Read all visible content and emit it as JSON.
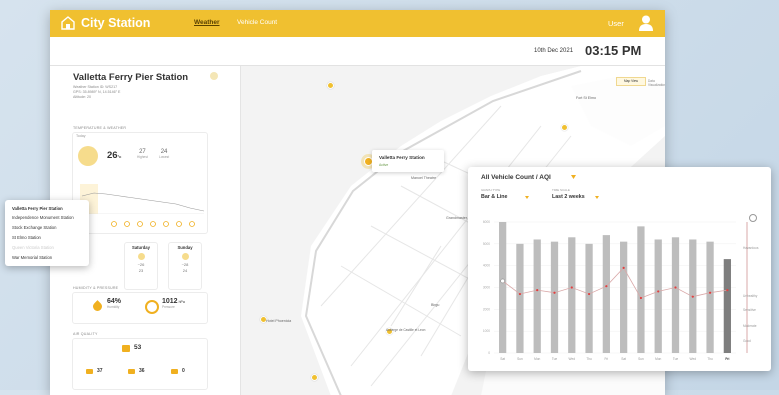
{
  "app": {
    "title": "City Station",
    "user_label": "User"
  },
  "nav": {
    "weather": "Weather",
    "vehicle_count": "Vehicle Count"
  },
  "header": {
    "date": "10th Dec 2021",
    "time": "03:15 PM"
  },
  "station": {
    "name": "Valletta Ferry Pier Station",
    "id_line": "Weather Station ID: WS217",
    "gps_line": "GPS: 35.8989° N, 14.5146° E",
    "alt_line": "Altitude: 20"
  },
  "sections": {
    "temp_weather": "Temperature & Weather",
    "humidity_pressure": "Humidity & Pressure",
    "air_quality": "Air Quality"
  },
  "weather": {
    "today_label": "Today",
    "temp": "26",
    "temp_unit": "°c",
    "high": "27",
    "high_label": "Highest",
    "low": "24",
    "low_label": "Lowest",
    "days": [
      {
        "name": "Saturday",
        "t1": "~26",
        "t2": "23"
      },
      {
        "name": "Sunday",
        "t1": "~28",
        "t2": "24"
      }
    ]
  },
  "humidity": {
    "value": "64%",
    "label": "Humidity",
    "pressure": "1012",
    "pressure_unit": "hPa",
    "pressure_label": "Pressure"
  },
  "air_quality": {
    "aqi": "53",
    "sub1": "37",
    "sub2": "36",
    "sub3": "0"
  },
  "station_dropdown": {
    "options": [
      "Valletta Ferry Pier Station",
      "Independence Monument Station",
      "Stock Exchange Station",
      "St Elmo Station",
      "Queen Victoria Station",
      "War Memorial Station"
    ],
    "selected_index": 0,
    "disabled_index": 4
  },
  "map": {
    "callout_name": "Valletta Ferry Station",
    "callout_status": "Active",
    "toggle_active": "Map View",
    "toggle_other": "Data Visualization",
    "labels": [
      "Fort St Elmo",
      "Auberge de Castille et Leon",
      "Hotel Phoenicia",
      "Manoel Theatre",
      "Grandmaster",
      "Birgu"
    ]
  },
  "chart_card": {
    "title": "All Vehicle Count / AQI",
    "graph_type_label": "Graph Type",
    "graph_type_value": "Bar & Line",
    "time_scale_label": "Time Scale",
    "time_scale_value": "Last 2 weeks",
    "aqi_legend": [
      "Hazardous",
      "Unhealthy",
      "Sensitive",
      "Moderate",
      "Good"
    ]
  },
  "chart_data": {
    "type": "bar",
    "categories": [
      "Sat",
      "Sun",
      "Mon",
      "Tue",
      "Wed",
      "Thu",
      "Fri",
      "Sat",
      "Sun",
      "Mon",
      "Tue",
      "Wed",
      "Thu",
      "Fri"
    ],
    "series": [
      {
        "values": [
          6000,
          5000,
          5200,
          5100,
          5300,
          5000,
          5400,
          5100,
          5800,
          5200,
          5300,
          5200,
          5100,
          4300
        ]
      },
      {
        "values": [
          55,
          45,
          48,
          46,
          50,
          45,
          51,
          65,
          42,
          47,
          50,
          43,
          46,
          48
        ]
      }
    ],
    "ylim": [
      0,
      6000
    ],
    "y_ticks": [
      "6000",
      "5000",
      "4000",
      "3000",
      "2000",
      "1000",
      "0"
    ],
    "colors": {
      "bar": "#bdbdbd",
      "bar_last": "#7e7e7e",
      "line": "#d9a8a8",
      "point": "#e04040"
    }
  }
}
